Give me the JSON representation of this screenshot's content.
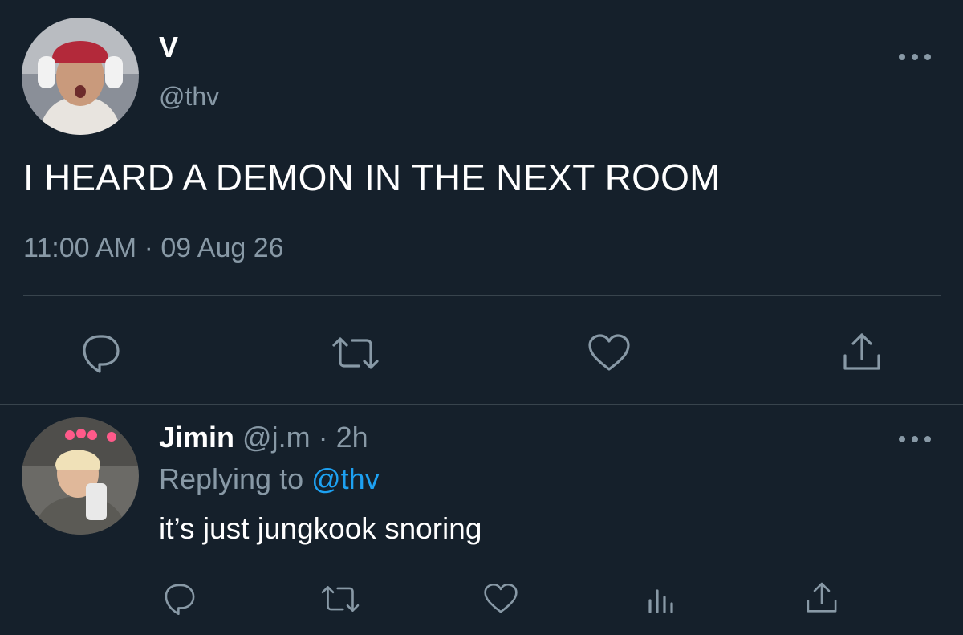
{
  "tweet": {
    "author_name": "V",
    "author_handle": "@thv",
    "text": "I HEARD A DEMON IN THE NEXT ROOM",
    "time": "11:00 AM",
    "separator": "·",
    "date": "09 Aug 26",
    "avatar_icon": "profile-photo"
  },
  "reply": {
    "author_name": "Jimin",
    "author_handle": "@j.m",
    "separator": "·",
    "age": "2h",
    "replying_prefix": "Replying to",
    "replying_handle": "@thv",
    "text": "it’s just jungkook snoring",
    "avatar_icon": "profile-photo"
  },
  "icons": {
    "reply": "speech-bubble-icon",
    "retweet": "retweet-icon",
    "like": "heart-icon",
    "share": "share-icon",
    "analytics": "analytics-icon",
    "more": "more-dots-icon"
  },
  "colors": {
    "background": "#15202b",
    "muted_text": "#8899a6",
    "link": "#1da1f2",
    "divider": "#38444d"
  }
}
